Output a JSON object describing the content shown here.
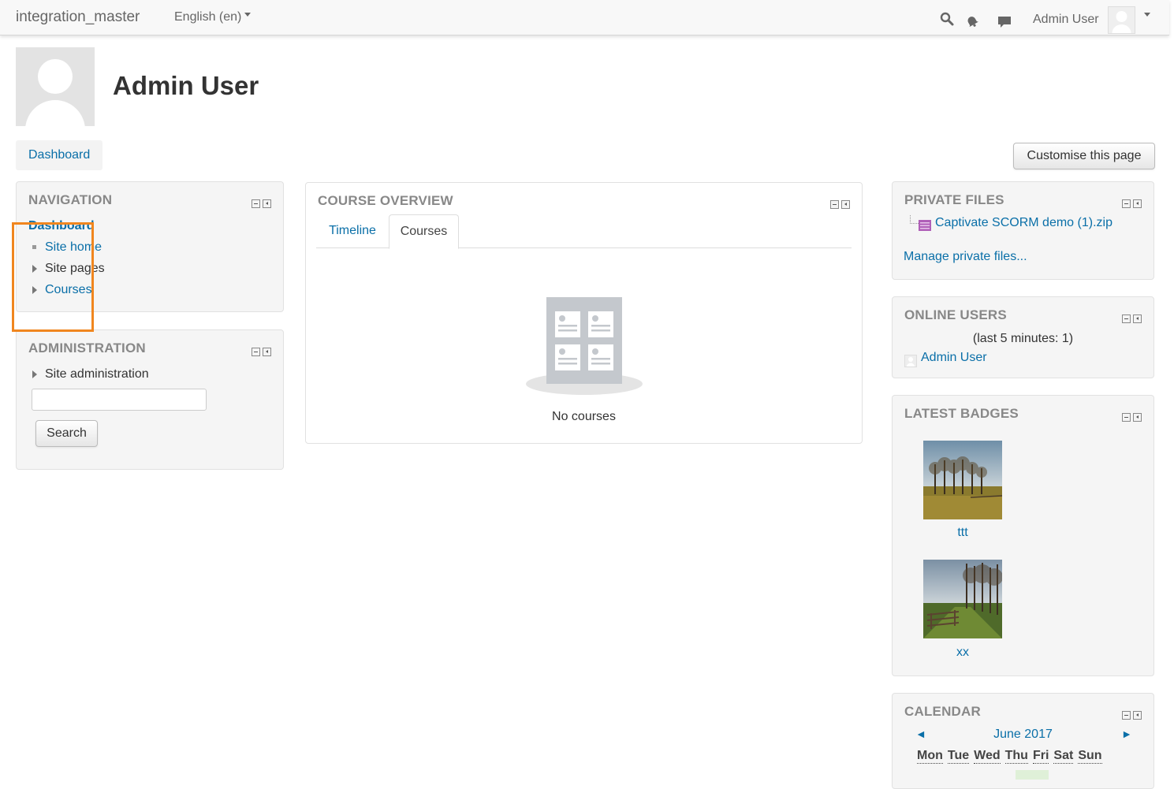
{
  "navbar": {
    "site_name": "integration_master",
    "language": "English (en)",
    "user_name": "Admin User",
    "icons": [
      "search-icon",
      "bell-icon",
      "chat-icon"
    ]
  },
  "header": {
    "title": "Admin User"
  },
  "breadcrumb": {
    "item": "Dashboard"
  },
  "customise_button": "Customise this page",
  "navigation_block": {
    "title": "NAVIGATION",
    "items": [
      {
        "label": "Dashboard"
      },
      {
        "label": "Site home"
      },
      {
        "label": "Site pages"
      },
      {
        "label": "Courses"
      }
    ]
  },
  "administration_block": {
    "title": "ADMINISTRATION",
    "item": "Site administration",
    "search_value": "",
    "search_button": "Search"
  },
  "course_overview": {
    "title": "COURSE OVERVIEW",
    "tabs": [
      "Timeline",
      "Courses"
    ],
    "active_tab": "Courses",
    "empty_text": "No courses"
  },
  "private_files": {
    "title": "PRIVATE FILES",
    "file": "Captivate SCORM demo (1).zip",
    "manage_link": "Manage private files..."
  },
  "online_users": {
    "title": "ONLINE USERS",
    "period": "(last 5 minutes: 1)",
    "user": "Admin User"
  },
  "latest_badges": {
    "title": "LATEST BADGES",
    "badges": [
      {
        "name": "ttt"
      },
      {
        "name": "xx"
      }
    ]
  },
  "calendar": {
    "title": "CALENDAR",
    "month": "June 2017",
    "prev": "◄",
    "next": "►",
    "days": [
      "Mon",
      "Tue",
      "Wed",
      "Thu",
      "Fri",
      "Sat",
      "Sun"
    ]
  },
  "colors": {
    "link": "#0a6fa8",
    "highlight": "#f0861f",
    "block_bg": "#f5f5f5"
  }
}
